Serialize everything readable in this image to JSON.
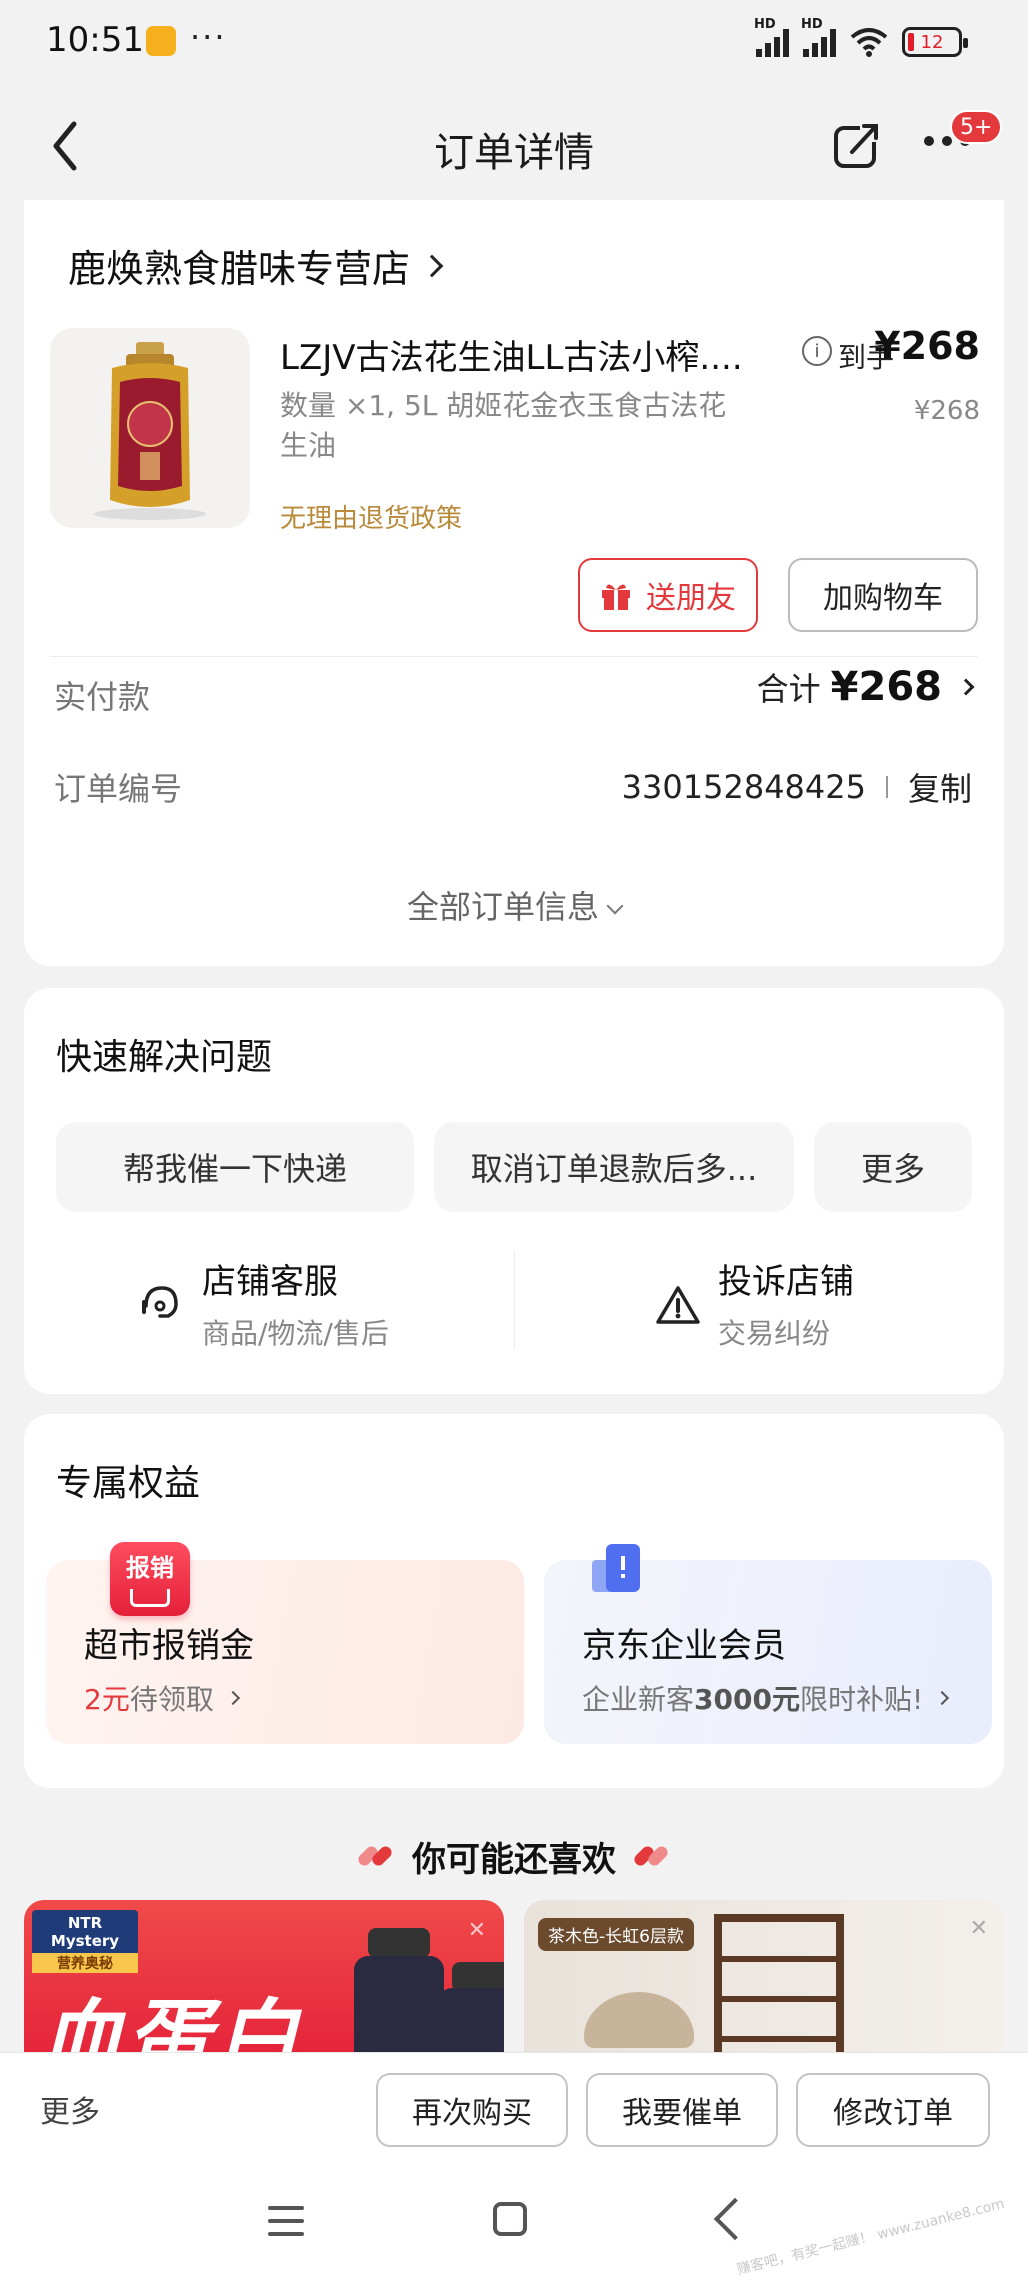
{
  "status_bar": {
    "time": "10:51",
    "battery": "12",
    "network_labels": [
      "HD",
      "HD"
    ]
  },
  "nav": {
    "title": "订单详情",
    "badge": "5+"
  },
  "order": {
    "store_name": "鹿焕熟食腊味专营店",
    "product": {
      "title": "LZJV古法花生油LL古法小榨....",
      "spec": "数量 ×1, 5L 胡姬花金衣玉食古法花生油",
      "price_label": "到手",
      "price": "¥268",
      "original_price": "¥268",
      "policy": "无理由退货政策"
    },
    "buttons": {
      "gift": "送朋友",
      "cart": "加购物车"
    },
    "payment": {
      "label": "实付款",
      "total_prefix": "合计",
      "total": "¥268"
    },
    "order_no": {
      "label": "订单编号",
      "value": "330152848425",
      "copy": "复制"
    },
    "all_info": "全部订单信息"
  },
  "quick": {
    "title": "快速解决问题",
    "buttons": [
      "帮我催一下快递",
      "取消订单退款后多...",
      "更多"
    ],
    "services": [
      {
        "title": "店铺客服",
        "sub": "商品/物流/售后",
        "icon": "headset-icon"
      },
      {
        "title": "投诉店铺",
        "sub": "交易纠纷",
        "icon": "warning-icon"
      }
    ]
  },
  "benefits": {
    "title": "专属权益",
    "items": [
      {
        "title": "超市报销金",
        "highlight": "2元",
        "sub": "待领取",
        "icon_text": "报销"
      },
      {
        "title": "京东企业会员",
        "sub_prefix": "企业新客",
        "highlight": "3000元",
        "sub": "限时补贴!"
      }
    ]
  },
  "recommend": {
    "title": "你可能还喜欢",
    "items": [
      {
        "brand": "NTR Mystery",
        "brand_sub": "营养奥秘",
        "headline": "血蛋白"
      },
      {
        "tag": "茶木色-长虹6层款"
      }
    ]
  },
  "bottom_bar": {
    "more": "更多",
    "buttons": [
      "再次购买",
      "我要催单",
      "修改订单"
    ]
  },
  "watermark": "赚客吧，有奖一起赚！ www.zuanke8.com",
  "colors": {
    "accent": "#e4393c",
    "policy": "#b88a3a",
    "background": "#f2f2f2"
  }
}
